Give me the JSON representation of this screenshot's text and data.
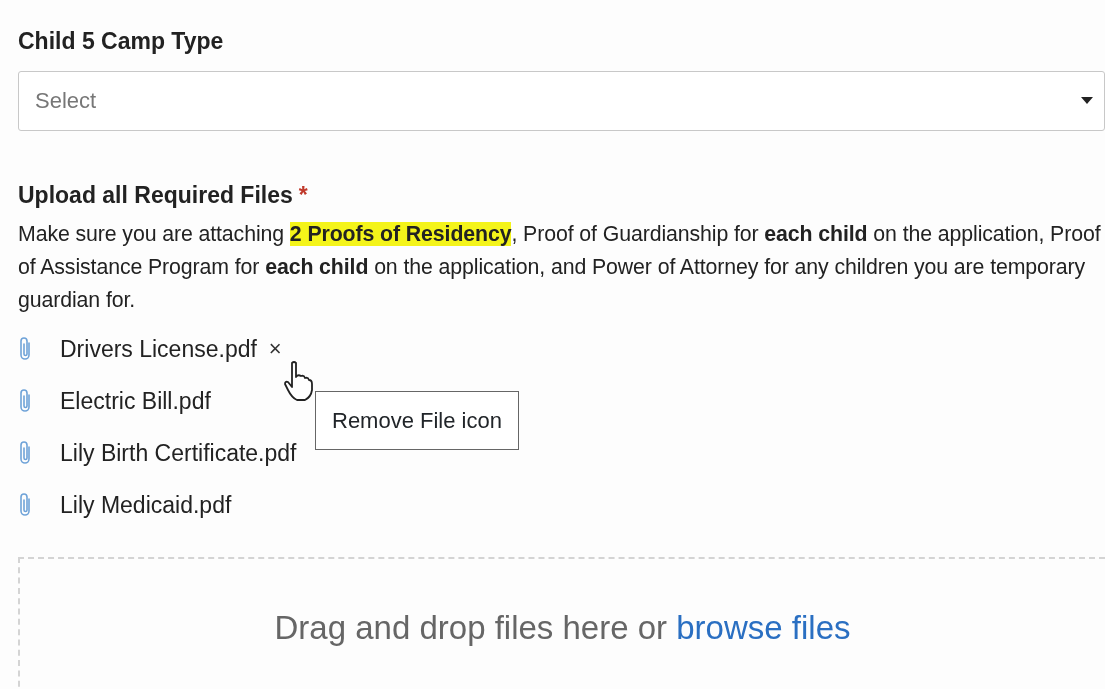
{
  "camp_type": {
    "label": "Child 5 Camp Type",
    "placeholder": "Select"
  },
  "upload": {
    "label": "Upload all Required Files",
    "required": true,
    "required_mark": "*",
    "description": [
      {
        "text": "Make sure you are attaching ",
        "bold": false,
        "highlight": false
      },
      {
        "text": "2 Proofs of Residency",
        "bold": true,
        "highlight": true
      },
      {
        "text": ", Proof of Guardianship for ",
        "bold": false,
        "highlight": false
      },
      {
        "text": "each child",
        "bold": true,
        "highlight": false
      },
      {
        "text": " on the application, Proof of Assistance Program for ",
        "bold": false,
        "highlight": false
      },
      {
        "text": "each child",
        "bold": true,
        "highlight": false
      },
      {
        "text": " on the application, and Power of Attorney for any children you are temporary guardian for.",
        "bold": false,
        "highlight": false
      }
    ],
    "files": [
      {
        "name": "Drivers License.pdf",
        "remove": "×"
      },
      {
        "name": "Electric Bill.pdf"
      },
      {
        "name": "Lily Birth Certificate.pdf"
      },
      {
        "name": "Lily Medicaid.pdf"
      }
    ],
    "tooltip": "Remove File icon",
    "dropzone": {
      "text": "Drag and drop files here or ",
      "link": "browse files"
    }
  }
}
